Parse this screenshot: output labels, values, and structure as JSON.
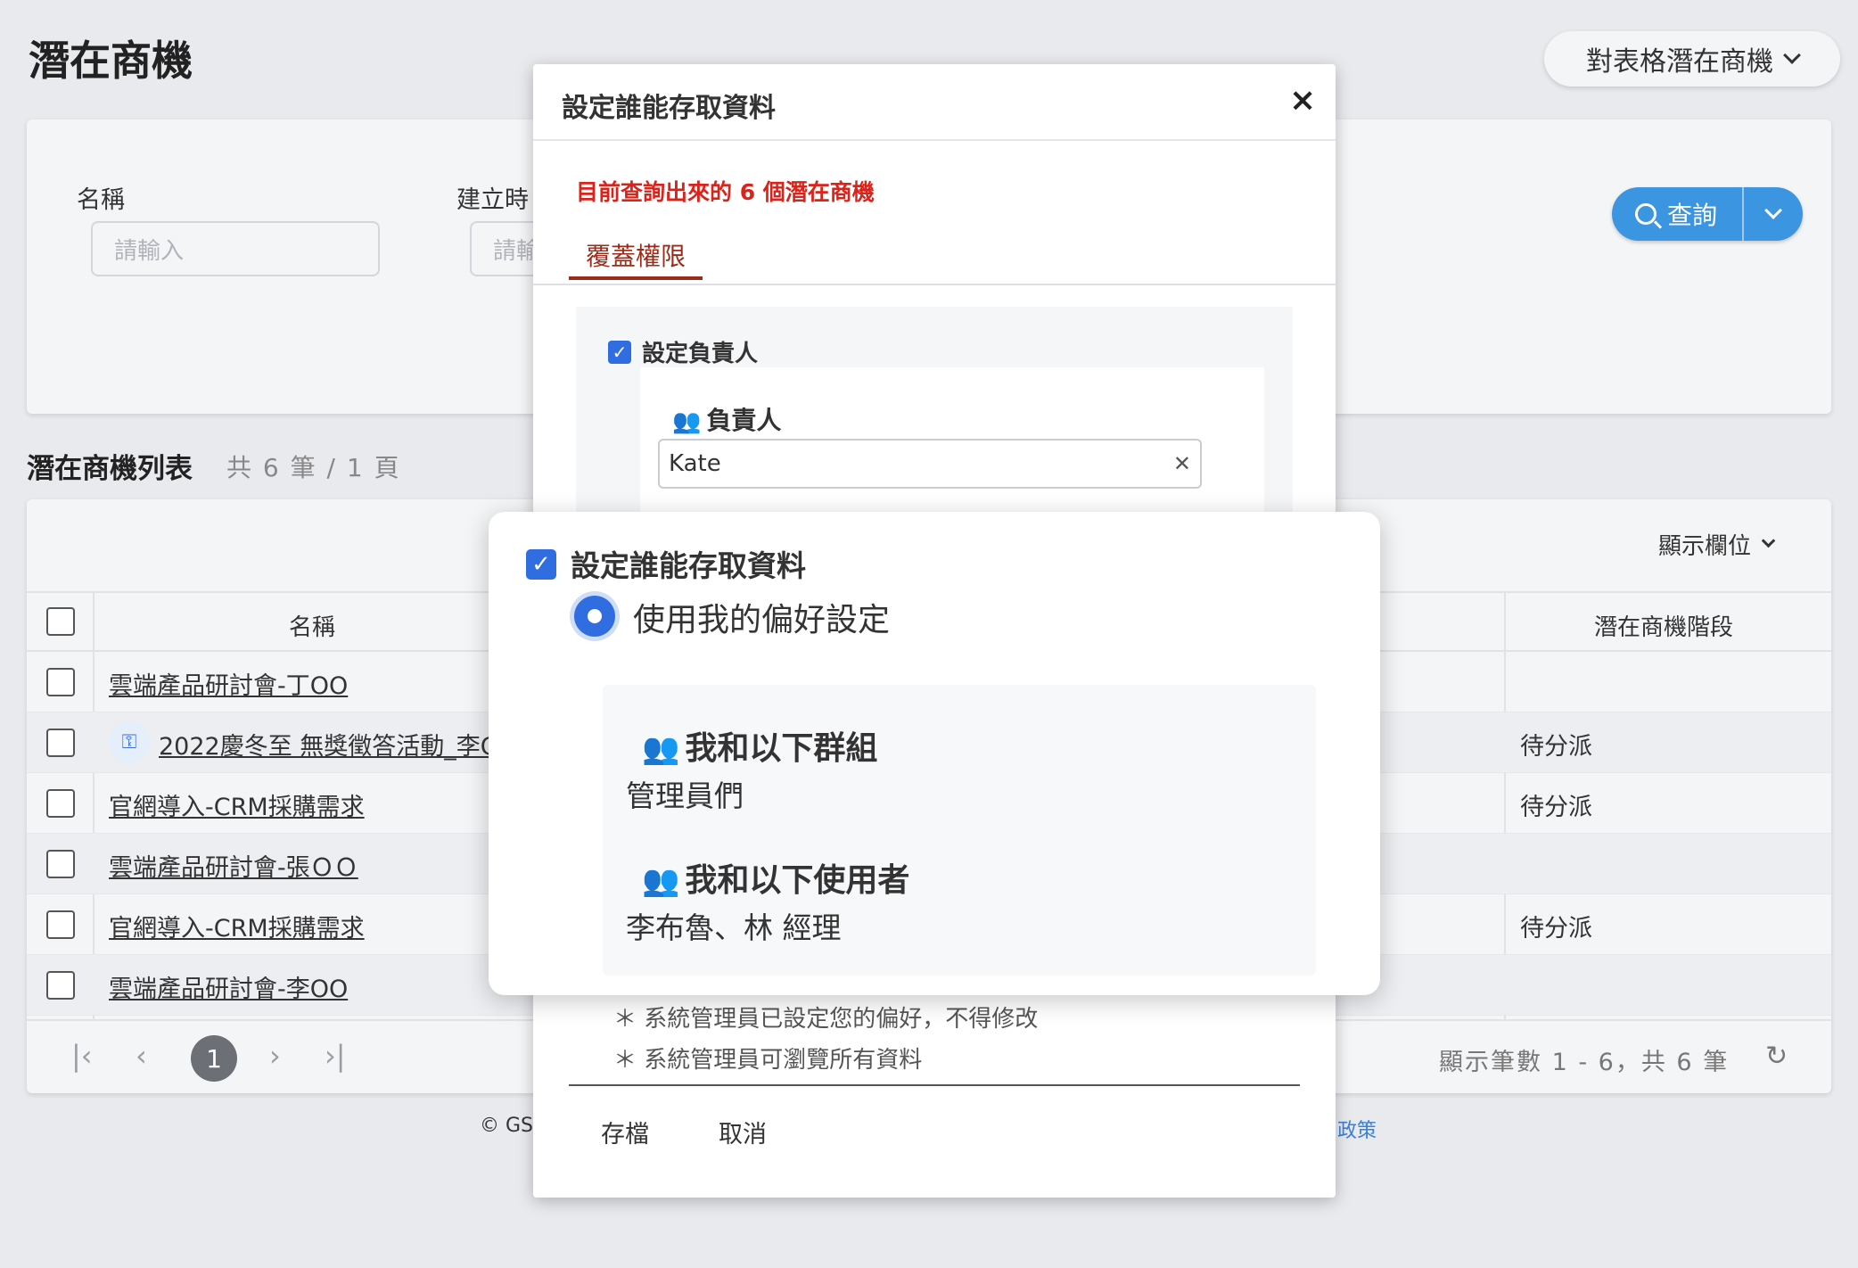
{
  "page": {
    "title": "潛在商機",
    "top_dropdown_label": "對表格潛在商機"
  },
  "filters": {
    "name_label": "名稱",
    "name_placeholder": "請輸入",
    "created_label": "建立時",
    "created_placeholder": "請輸",
    "search_label": "查詢"
  },
  "list": {
    "title": "潛在商機列表",
    "count_text": "共 6 筆 / 1 頁",
    "columns_label": "顯示欄位",
    "col_name": "名稱",
    "col_stage": "潛在商機階段",
    "rows": [
      {
        "name": "雲端產品研討會-丁OO",
        "stage": ""
      },
      {
        "name": "2022慶冬至 無獎徵答活動_李O",
        "stage": "待分派"
      },
      {
        "name": "官網導入-CRM採購需求",
        "stage": "待分派"
      },
      {
        "name": "雲端產品研討會-張ＯＯ",
        "stage": ""
      },
      {
        "name": "官網導入-CRM採購需求",
        "stage": "待分派"
      },
      {
        "name": "雲端產品研討會-李OO",
        "stage": ""
      }
    ],
    "pagination": {
      "current_page": "1",
      "info": "顯示筆數 1 - 6，共 6 筆"
    }
  },
  "footer": {
    "copyright": "© GS",
    "policy_link": "政策"
  },
  "modal": {
    "title": "設定誰能存取資料",
    "close_glyph": "×",
    "warning": "目前查詢出來的 6 個潛在商機",
    "tab": "覆蓋權限",
    "set_owner_label": "設定負責人",
    "owner_field_label": "負責人",
    "owner_value": "Kate",
    "notes": [
      "系統管理員已設定您的偏好，不得修改",
      "系統管理員可瀏覽所有資料"
    ],
    "save_label": "存檔",
    "cancel_label": "取消"
  },
  "callout": {
    "title": "設定誰能存取資料",
    "radio_label": "使用我的偏好設定",
    "groups_heading": "我和以下群組",
    "groups_value": "管理員們",
    "users_heading": "我和以下使用者",
    "users_value": "李布魯、林 經理"
  },
  "colors": {
    "primary_blue": "#2f6de1",
    "search_blue": "#3c95e0",
    "warning_red": "#d9241c",
    "tab_red": "#9c2b1a",
    "group_icon": "#e59f84"
  }
}
